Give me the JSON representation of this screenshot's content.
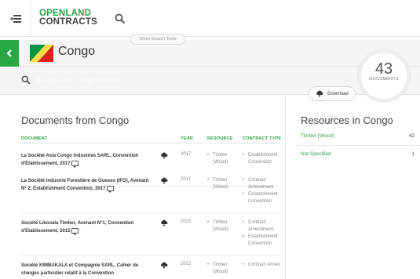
{
  "header": {
    "logo_line1": "OPENLAND",
    "logo_line2": "CONTRACTS",
    "search_tools_label": "Show Search Tools"
  },
  "country": {
    "name": "Congo",
    "flag_colors": {
      "green": "#009543",
      "yellow": "#fbde4a",
      "red": "#dc241f"
    }
  },
  "search": {
    "placeholder": "Search within Congo contracts…"
  },
  "summary": {
    "count": "43",
    "count_label": "DOCUMENTS",
    "download_label": "Download"
  },
  "documents": {
    "title": "Documents from Congo",
    "columns": {
      "document": "DOCUMENT",
      "year": "YEAR",
      "resource": "RESOURCE",
      "contract_type": "CONTRACT TYPE"
    },
    "rows": [
      {
        "name": "La Société Asia Congo Industries SARL, Convention d'Etablissement, 2017",
        "year": "2017",
        "resources": [
          "Timber (Wood)"
        ],
        "contract_types": [
          "Establishment Convention"
        ]
      },
      {
        "name": "La Société Industrie Forestière de Ouesso (IFO), Avenant N° 2, Establishment Convention, 2017",
        "year": "2017",
        "resources": [
          "Timber (Wood)"
        ],
        "contract_types": [
          "Contract Amendment",
          "Establishment Convention"
        ]
      },
      {
        "name": "Société Likouala Timber, Avenant N°1, Convention d'Etablissement, 2015",
        "year": "2015",
        "resources": [
          "Timber (Wood)"
        ],
        "contract_types": [
          "Contract Amendment",
          "Establishment Convention"
        ]
      },
      {
        "name": "Société KIMBAKALA et Compagnie SARL, Cahier de charges particulier relatif à la Convention",
        "year": "2012",
        "resources": [
          "Timber (Wood)"
        ],
        "contract_types": [
          "Contract Annex"
        ]
      }
    ]
  },
  "resources": {
    "title": "Resources in Congo",
    "items": [
      {
        "name": "Timber (Wood)",
        "count": "42"
      },
      {
        "name": "Not Specified",
        "count": "1"
      }
    ]
  },
  "colors": {
    "accent_green": "#2ca046",
    "button_green": "#28a745"
  }
}
